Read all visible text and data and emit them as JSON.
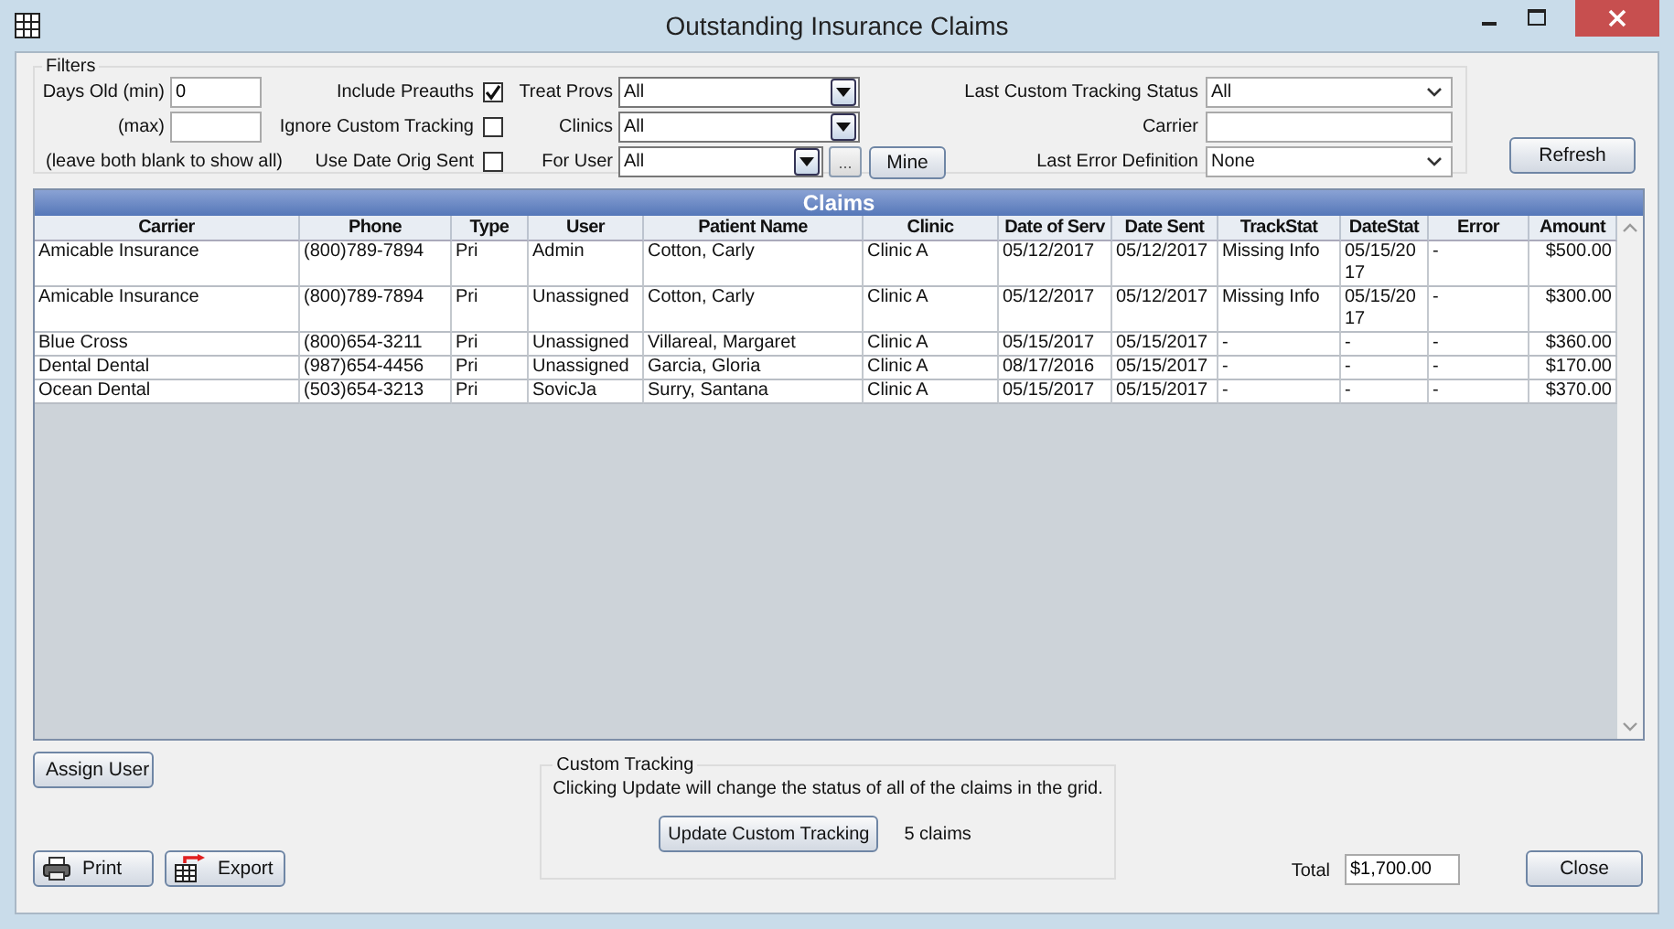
{
  "window": {
    "title": "Outstanding Insurance Claims"
  },
  "filters": {
    "legend": "Filters",
    "days_old": [
      {
        "label": "Days Old (min)",
        "value": "0"
      },
      {
        "label": "(max)"
      }
    ],
    "hint": "(leave both blank to show all)",
    "checkboxes": [
      {
        "label": "Include Preauths",
        "checked": true
      },
      {
        "label": "Ignore Custom Tracking",
        "checked": false
      },
      {
        "label": "Use Date Orig Sent",
        "checked": false
      }
    ],
    "combos": [
      {
        "label": "Treat Provs",
        "value": "All"
      },
      {
        "label": "Clinics",
        "value": "All"
      },
      {
        "label": "For User",
        "value": "All",
        "browse": "...",
        "mine": "Mine"
      }
    ],
    "right_fields": [
      {
        "label": "Last Custom Tracking Status",
        "kind": "dropdown",
        "value": "All"
      },
      {
        "label": "Carrier",
        "kind": "text"
      },
      {
        "label": "Last Error Definition",
        "kind": "dropdown",
        "value": "None"
      }
    ]
  },
  "refresh": "Refresh",
  "grid": {
    "title": "Claims",
    "columns": [
      "Carrier",
      "Phone",
      "Type",
      "User",
      "Patient Name",
      "Clinic",
      "Date of Serv",
      "Date Sent",
      "TrackStat",
      "DateStat",
      "Error",
      "Amount"
    ],
    "rows": [
      [
        "Amicable Insurance",
        "(800)789-7894",
        "Pri",
        "Admin",
        "Cotton, Carly",
        "Clinic A",
        "05/12/2017",
        "05/12/2017",
        "Missing Info",
        "05/15/2017",
        "-",
        "$500.00"
      ],
      [
        "Amicable Insurance",
        "(800)789-7894",
        "Pri",
        "Unassigned",
        "Cotton, Carly",
        "Clinic A",
        "05/12/2017",
        "05/12/2017",
        "Missing Info",
        "05/15/2017",
        "-",
        "$300.00"
      ],
      [
        "Blue Cross",
        "(800)654-3211",
        "Pri",
        "Unassigned",
        "Villareal, Margaret",
        "Clinic A",
        "05/15/2017",
        "05/15/2017",
        "-",
        "-",
        "-",
        "$360.00"
      ],
      [
        "Dental Dental",
        "(987)654-4456",
        "Pri",
        "Unassigned",
        "Garcia, Gloria",
        "Clinic A",
        "08/17/2016",
        "05/15/2017",
        "-",
        "-",
        "-",
        "$170.00"
      ],
      [
        "Ocean Dental",
        "(503)654-3213",
        "Pri",
        "SovicJa",
        "Surry, Santana",
        "Clinic A",
        "05/15/2017",
        "05/15/2017",
        "-",
        "-",
        "-",
        "$370.00"
      ]
    ]
  },
  "assign_user": "Assign User",
  "print": "Print",
  "export": "Export",
  "custom_tracking": {
    "legend": "Custom Tracking",
    "note": "Clicking Update will change the status of all of the claims in the grid.",
    "button": "Update Custom Tracking",
    "count": "5 claims"
  },
  "total": {
    "label": "Total",
    "value": "$1,700.00"
  },
  "close": "Close"
}
